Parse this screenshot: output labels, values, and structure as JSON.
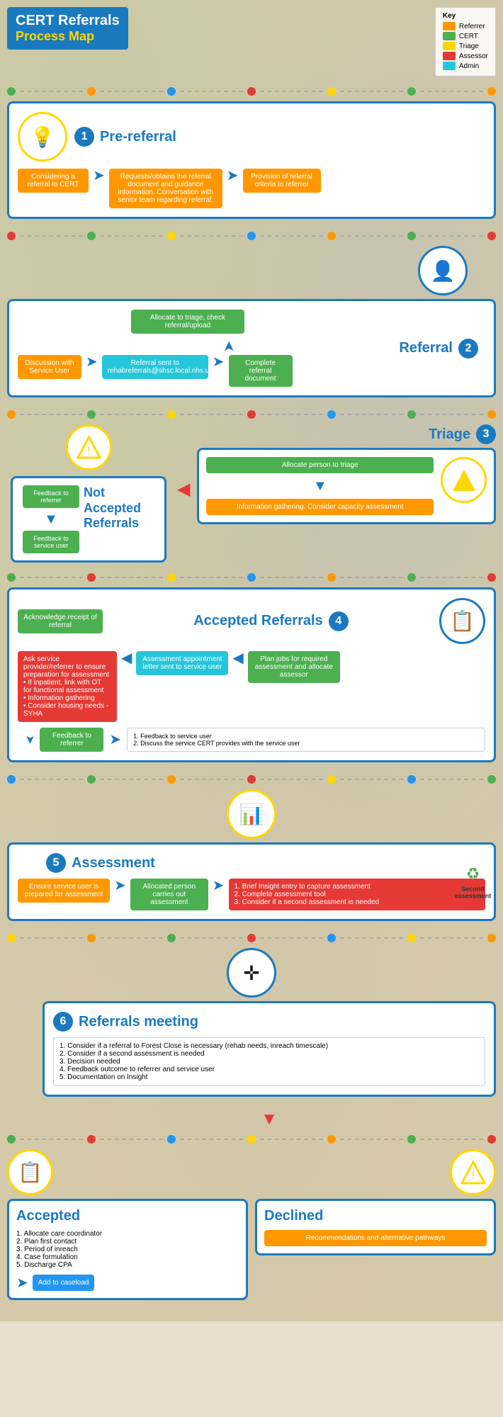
{
  "header": {
    "title_line1": "CERT Referrals",
    "title_line2": "Process Map"
  },
  "key": {
    "title": "Key",
    "items": [
      {
        "label": "Referrer",
        "color": "#ff9800"
      },
      {
        "label": "CERT",
        "color": "#4caf50"
      },
      {
        "label": "Triage",
        "color": "#ffd700"
      },
      {
        "label": "Assessor",
        "color": "#e53935"
      },
      {
        "label": "Admin",
        "color": "#26c6da"
      }
    ]
  },
  "sections": {
    "pre_referral": {
      "number": "1",
      "title": "Pre-referral",
      "step1": "Considering a referral to CERT",
      "step2": "Requests/obtains the referral document and guidance information. Conversation with senior team regarding referral.",
      "step3": "Provision of referral criteria to referrer"
    },
    "referral": {
      "number": "2",
      "title": "Referral",
      "allocate": "Allocate to triage, check referral/upload",
      "step1": "Discussion with Service User",
      "step2": "Referral sent to rehabreferrals@shsc.local.nhs.uk",
      "step3": "Complete referral document"
    },
    "triage": {
      "number": "3",
      "title": "Triage",
      "not_accepted_title": "Not\nAccepted\nReferrals",
      "feedback_referrer": "Feedback to referrer",
      "feedback_user": "Feedback to service user",
      "allocate": "Allocate person to triage",
      "info": "Information gathering. Consider capacity assessment"
    },
    "accepted_referrals": {
      "number": "4",
      "title": "Accepted Referrals",
      "acknowledge": "Acknowledge receipt of referral",
      "ask": "Ask service provider/referrer to ensure preparation for assessment\n• If inpatient, link with OT for functional assessment\n• Information gathering\n• Consider housing needs - SYHA",
      "assessment_letter": "Assessment appointment letter sent to service user",
      "plan_jobs": "Plan jobs for required assessment and allocate assessor",
      "feedback": "Feedback to referrer",
      "feedback_detail": "1. Feedback to service user\n2. Discuss the service CERT provides with the service user"
    },
    "assessment": {
      "number": "5",
      "title": "Assessment",
      "ensure": "Ensure service user is prepared for assessment",
      "allocated": "Allocated person carries out assessment",
      "steps": "1. Brief Insight entry to capture assessment\n2. Complete assessment tool\n3. Consider if a second assessment is needed",
      "second_assessment": "Second\nassessment"
    },
    "referrals_meeting": {
      "number": "6",
      "title": "Referrals meeting",
      "steps": "1. Consider if a referral to Forest Close is necessary (rehab needs, inreach timescale)\n2. Consider if a second assessment is needed\n3. Decision needed\n4. Feedback outcome to referrer and service user\n5. Documentation on Insight"
    },
    "accepted": {
      "title": "Accepted",
      "steps": "1. Allocate care coordinator\n2. Plan first contact\n3. Period of inreach\n4. Case formulation\n5. Discharge CPA",
      "add_caseload": "Add to caseload"
    },
    "declined": {
      "title": "Declined",
      "recommendations": "Recommendations and alternative pathways"
    }
  }
}
